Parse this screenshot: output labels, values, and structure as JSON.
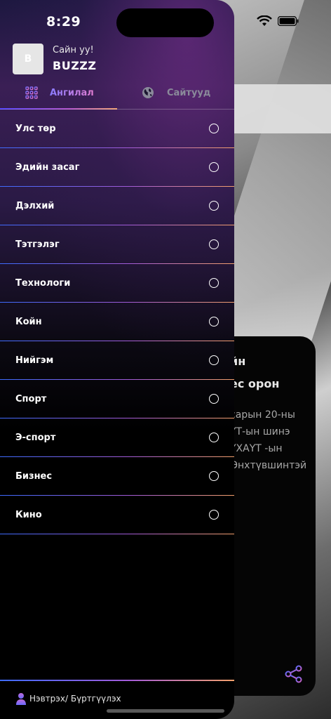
{
  "status_bar": {
    "time": "8:29"
  },
  "profile": {
    "avatar_letter": "B",
    "greeting": "Сайн уу!",
    "name": "BUZZZ"
  },
  "tabs": [
    {
      "label": "Ангилал",
      "icon": "grid-icon",
      "active": true
    },
    {
      "label": "Сайтууд",
      "icon": "globe-icon",
      "active": false
    }
  ],
  "menu": [
    {
      "label": "Улс төр"
    },
    {
      "label": "Эдийн засаг"
    },
    {
      "label": "Дэлхий"
    },
    {
      "label": "Тэтгэлэг"
    },
    {
      "label": "Технологи"
    },
    {
      "label": "Койн"
    },
    {
      "label": "Нийгэм"
    },
    {
      "label": "Спорт"
    },
    {
      "label": "Э-спорт"
    },
    {
      "label": "Бизнес"
    },
    {
      "label": "Кино"
    }
  ],
  "footer": {
    "label": "Нэвтрэх/ Бүртгүүлэх",
    "icon": "person-icon"
  },
  "background": {
    "heading_line1": "йн",
    "heading_line2": "ес орон",
    "body_line1": "сарын 20-ны",
    "body_line2": "ҮТ-ын  шинэ",
    "body_line3": "ҮХАҮТ   -ын",
    "body_line4": "Өнхтүвшинтэй"
  },
  "colors": {
    "accent_start": "#3d6bff",
    "accent_mid": "#a35bd8",
    "accent_end": "#f3a06b",
    "drawer_bg": "#000000"
  }
}
